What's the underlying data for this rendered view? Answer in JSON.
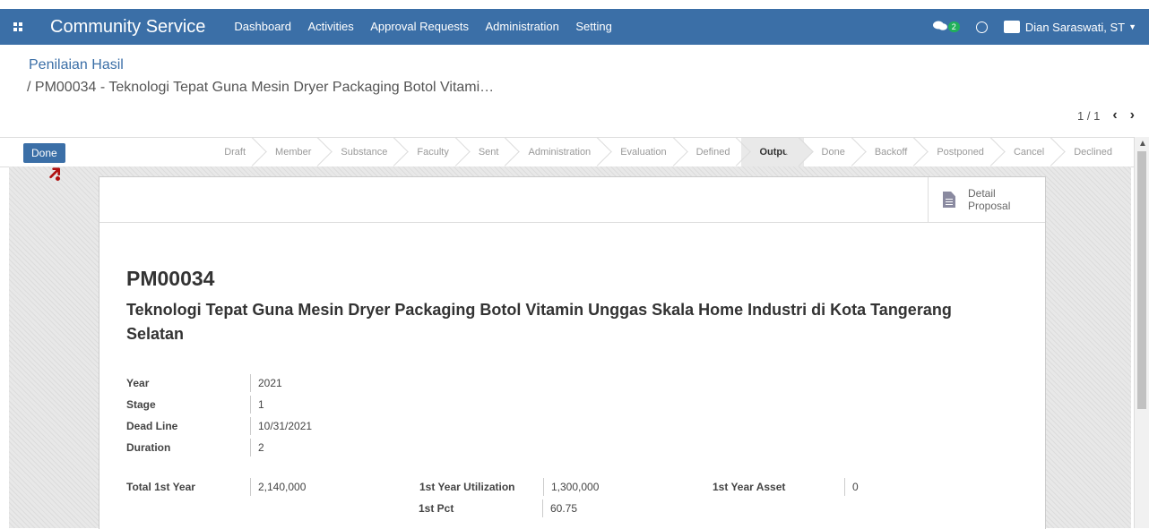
{
  "header": {
    "app_title": "Community Service",
    "nav": [
      "Dashboard",
      "Activities",
      "Approval Requests",
      "Administration",
      "Setting"
    ],
    "chat_count": "2",
    "user_name": "Dian Saraswati, ST"
  },
  "breadcrumb": {
    "parent": "Penilaian Hasil",
    "current": "/ PM00034 - Teknologi Tepat Guna Mesin Dryer Packaging Botol Vitami…"
  },
  "pager": {
    "value": "1 / 1",
    "prev": "‹",
    "next": "›"
  },
  "actions": {
    "done_label": "Done"
  },
  "stages": [
    "Draft",
    "Member",
    "Substance",
    "Faculty",
    "Sent",
    "Administration",
    "Evaluation",
    "Defined",
    "Output",
    "Done",
    "Backoff",
    "Postponed",
    "Cancel",
    "Declined"
  ],
  "active_stage": "Output",
  "sheet": {
    "detail_button": [
      "Detail",
      "Proposal"
    ],
    "reference": "PM00034",
    "title": "Teknologi Tepat Guna Mesin Dryer Packaging Botol Vitamin Unggas Skala Home Industri di Kota Tangerang Selatan",
    "fields": [
      {
        "label": "Year",
        "value": "2021"
      },
      {
        "label": "Stage",
        "value": "1"
      },
      {
        "label": "Dead Line",
        "value": "10/31/2021"
      },
      {
        "label": "Duration",
        "value": "2"
      }
    ],
    "totals": {
      "total_1st_year_label": "Total 1st Year",
      "total_1st_year": "2,140,000",
      "utilization_label": "1st Year Utilization",
      "utilization": "1,300,000",
      "pct_label": "1st Pct",
      "pct": "60.75",
      "asset_label": "1st Year Asset",
      "asset": "0"
    }
  }
}
